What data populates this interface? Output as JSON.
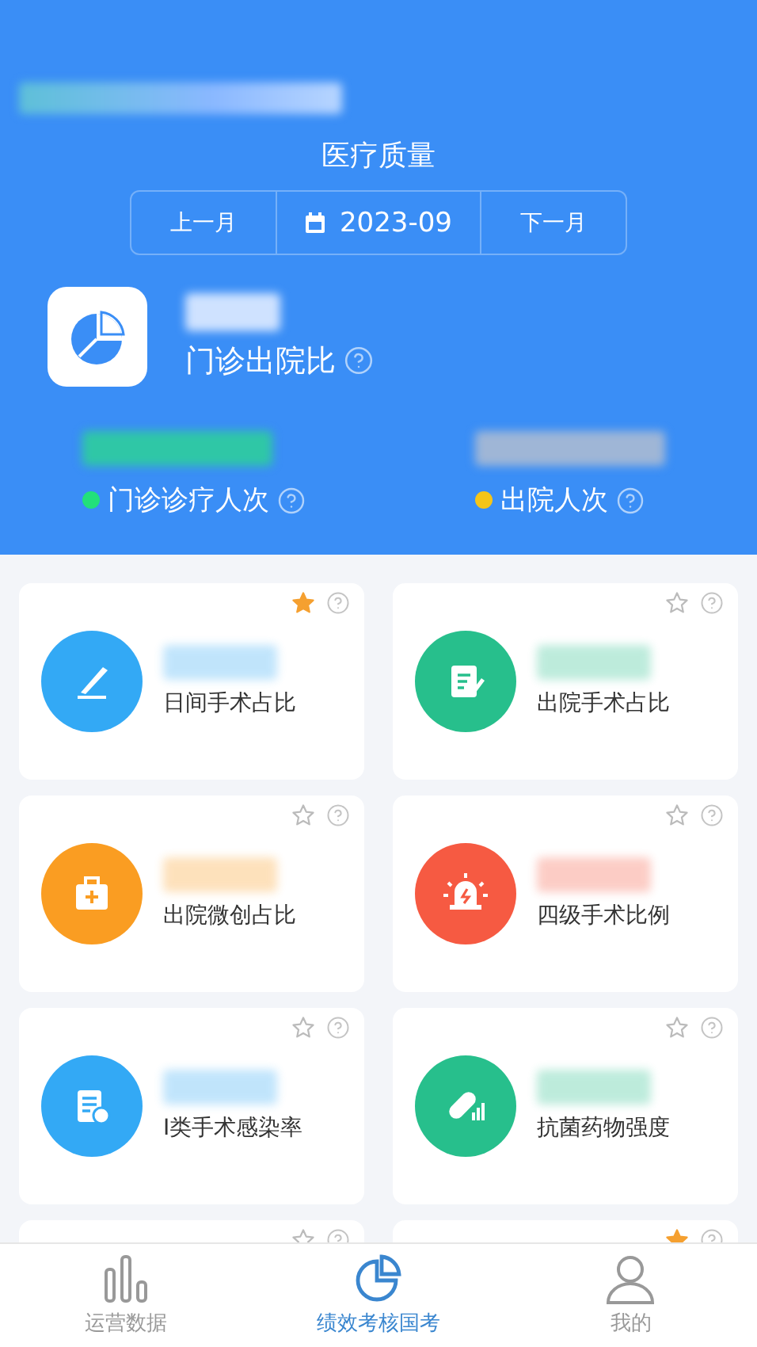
{
  "header": {
    "title": "医疗质量",
    "month_switch": {
      "previous": "上一月",
      "current": "2023-09",
      "next": "下一月"
    },
    "featured": {
      "label": "门诊出院比"
    },
    "stats": [
      {
        "label": "门诊诊疗人次",
        "color": "#22e07a"
      },
      {
        "label": "出院人次",
        "color": "#f5c518"
      }
    ]
  },
  "cards": [
    {
      "kind": "full",
      "title": "日间手术占比",
      "color": "#33a9f5",
      "starred": true
    },
    {
      "kind": "full",
      "title": "出院手术占比",
      "color": "#27bf8c",
      "starred": false
    },
    {
      "kind": "full",
      "title": "出院微创占比",
      "color": "#fa9d22",
      "starred": false
    },
    {
      "kind": "full",
      "title": "四级手术比例",
      "color": "#f65a42",
      "starred": false
    },
    {
      "kind": "full",
      "title": "Ⅰ类手术感染率",
      "color": "#33a9f5",
      "starred": false
    },
    {
      "kind": "full",
      "title": "抗菌药物强度",
      "color": "#27bf8c",
      "starred": false
    },
    {
      "kind": "cut",
      "starred": false
    },
    {
      "kind": "cut",
      "starred": true
    }
  ],
  "tab_bar": [
    {
      "label": "运营数据",
      "selected": false
    },
    {
      "label": "绩效考核国考",
      "selected": true
    },
    {
      "label": "我的",
      "selected": false
    }
  ]
}
